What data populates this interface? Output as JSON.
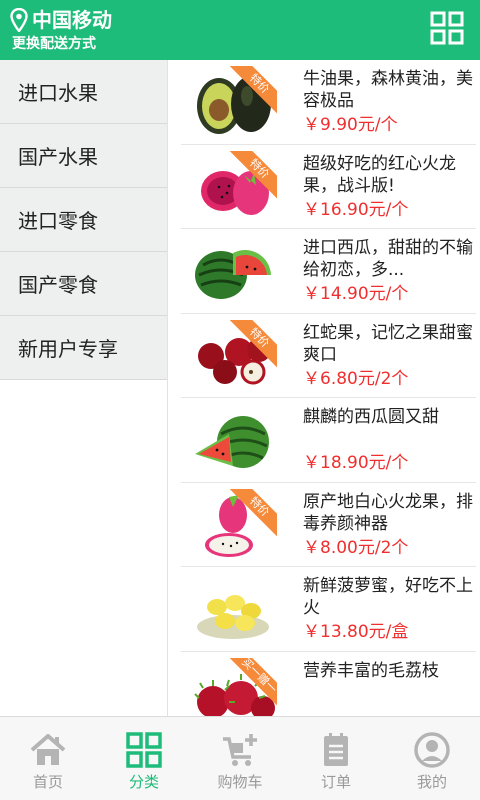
{
  "header": {
    "location": "中国移动",
    "subtitle": "更换配送方式",
    "pin_icon": "location-pin-icon",
    "grid_icon": "grid-icon"
  },
  "sidebar": {
    "items": [
      {
        "label": "进口水果"
      },
      {
        "label": "国产水果"
      },
      {
        "label": "进口零食"
      },
      {
        "label": "国产零食"
      },
      {
        "label": "新用户专享"
      }
    ]
  },
  "products": [
    {
      "name": "牛油果，森林黄油，美容极品",
      "price": "￥9.90元/个",
      "ribbon": "特价",
      "image": "avocado"
    },
    {
      "name": "超级好吃的红心火龙果，战斗版!",
      "price": "￥16.90元/个",
      "ribbon": "特价",
      "image": "dragon-fruit-red"
    },
    {
      "name": "进口西瓜，甜甜的不输给初恋，多...",
      "price": "￥14.90元/个",
      "ribbon": "",
      "image": "watermelon"
    },
    {
      "name": "红蛇果，记忆之果甜蜜爽口",
      "price": "￥6.80元/2个",
      "ribbon": "特价",
      "image": "red-apple"
    },
    {
      "name": "麒麟的西瓜圆又甜",
      "price": "￥18.90元/个",
      "ribbon": "",
      "image": "watermelon-slice"
    },
    {
      "name": "原产地白心火龙果，排毒养颜神器",
      "price": "￥8.00元/2个",
      "ribbon": "特价",
      "image": "dragon-fruit-white"
    },
    {
      "name": "新鲜菠萝蜜，好吃不上火",
      "price": "￥13.80元/盒",
      "ribbon": "",
      "image": "jackfruit"
    },
    {
      "name": "营养丰富的毛荔枝",
      "price": "",
      "ribbon": "买一赠一",
      "image": "rambutan"
    }
  ],
  "bottom_nav": {
    "items": [
      {
        "label": "首页",
        "icon": "home-icon"
      },
      {
        "label": "分类",
        "icon": "category-icon"
      },
      {
        "label": "购物车",
        "icon": "cart-icon"
      },
      {
        "label": "订单",
        "icon": "order-icon"
      },
      {
        "label": "我的",
        "icon": "profile-icon"
      }
    ]
  },
  "colors": {
    "brand": "#1ebc7a",
    "price": "#ef2f2f",
    "ribbon": "#f58a3b",
    "inactive": "#9a9a9a"
  }
}
